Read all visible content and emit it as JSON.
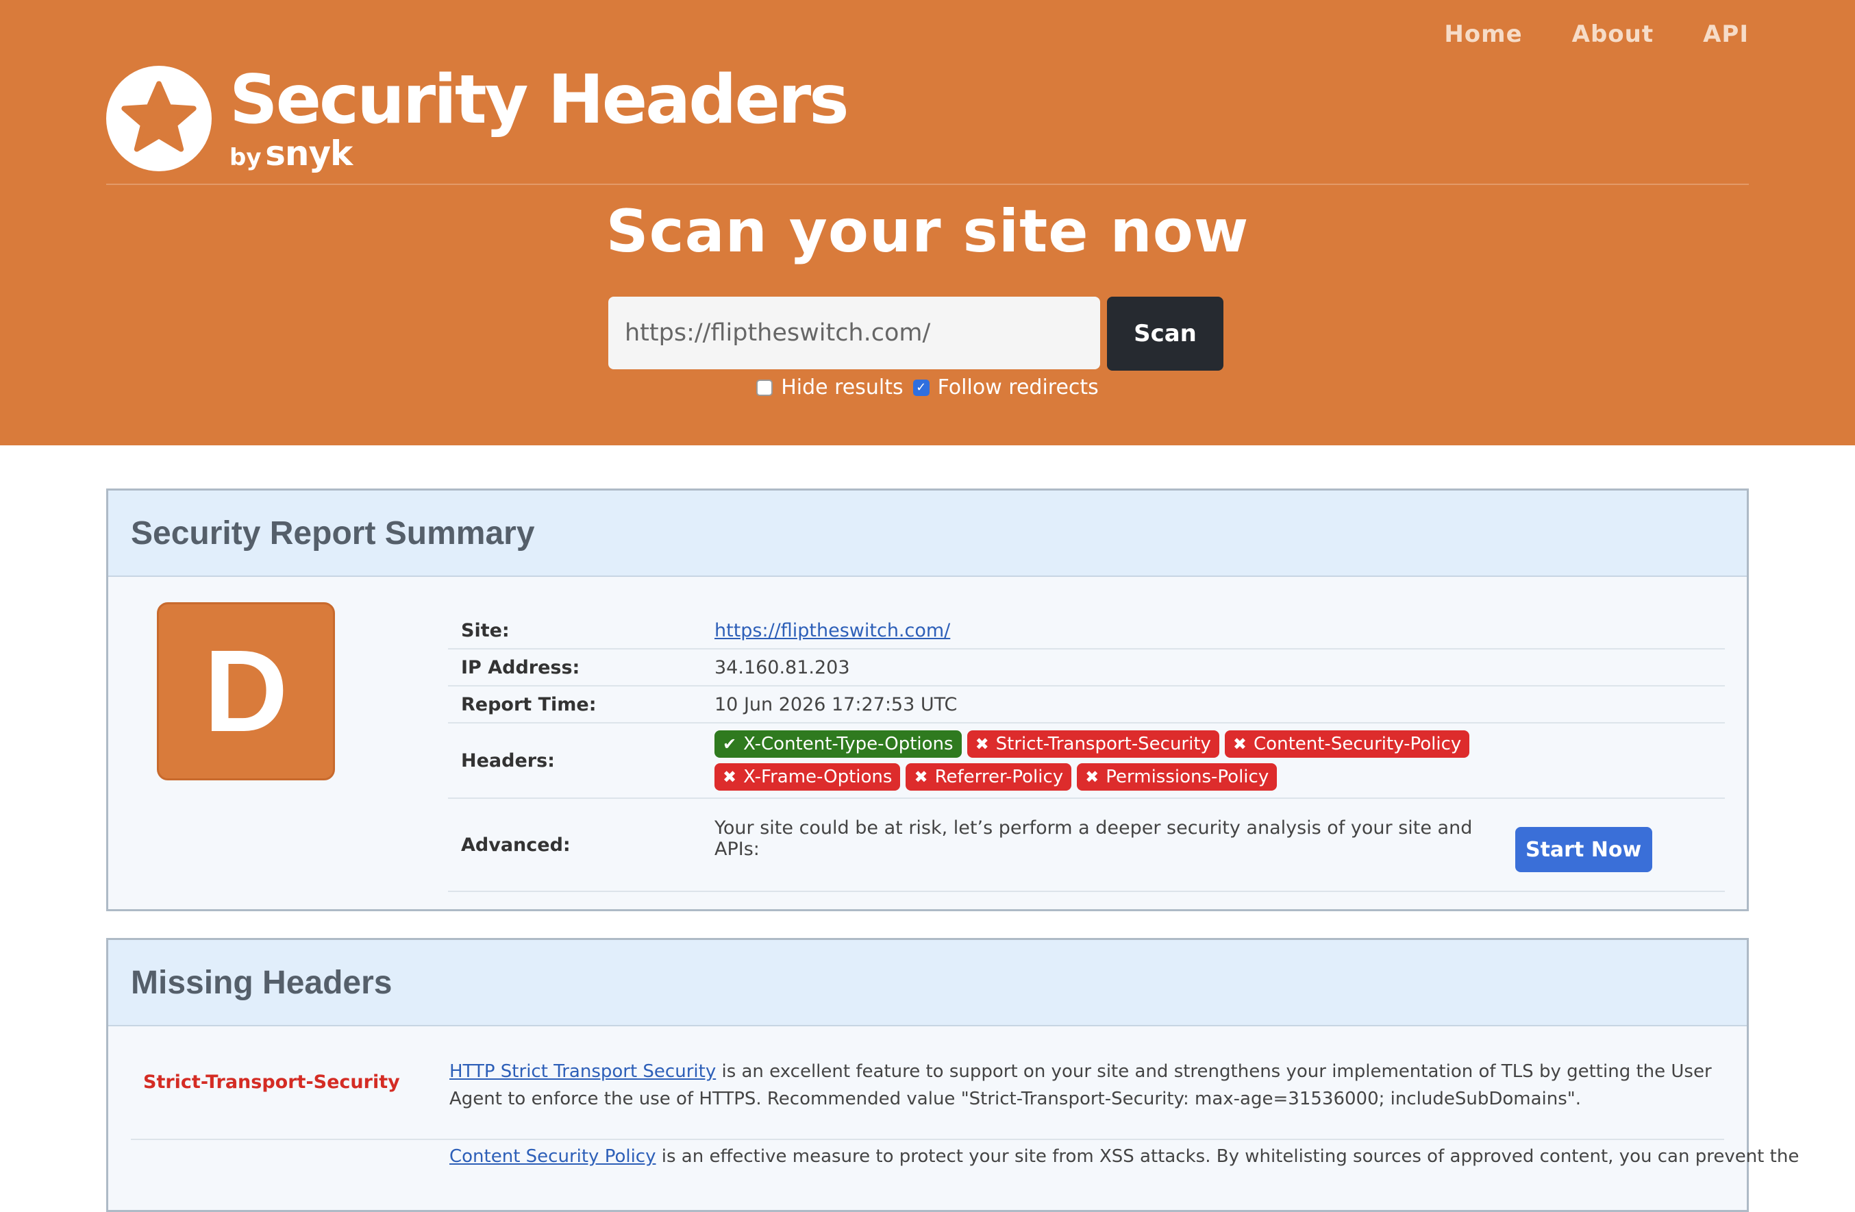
{
  "nav": {
    "home": "Home",
    "about": "About",
    "api": "API"
  },
  "logo": {
    "title": "Security Headers",
    "by": "by",
    "brand": "snyk",
    "icon": "star-icon"
  },
  "hero": {
    "title": "Scan your site now",
    "input_value": "https://fliptheswitch.com/",
    "scan_label": "Scan",
    "hide_results_label": "Hide results",
    "hide_results_checked": false,
    "follow_redirects_label": "Follow redirects",
    "follow_redirects_checked": true
  },
  "summary": {
    "title": "Security Report Summary",
    "grade": "D",
    "site_label": "Site:",
    "site_value": "https://fliptheswitch.com/",
    "ip_label": "IP Address:",
    "ip_value": "34.160.81.203",
    "time_label": "Report Time:",
    "time_value": "10 Jun 2026 17:27:53 UTC",
    "headers_label": "Headers:",
    "headers": [
      {
        "name": "X-Content-Type-Options",
        "status": "ok"
      },
      {
        "name": "Strict-Transport-Security",
        "status": "missing"
      },
      {
        "name": "Content-Security-Policy",
        "status": "missing"
      },
      {
        "name": "X-Frame-Options",
        "status": "missing"
      },
      {
        "name": "Referrer-Policy",
        "status": "missing"
      },
      {
        "name": "Permissions-Policy",
        "status": "missing"
      }
    ],
    "advanced_label": "Advanced:",
    "advanced_text": "Your site could be at risk, let’s perform a deeper security analysis of your site and APIs:",
    "start_label": "Start Now"
  },
  "missing": {
    "title": "Missing Headers",
    "rows": [
      {
        "name": "Strict-Transport-Security",
        "link": "HTTP Strict Transport Security",
        "text": " is an excellent feature to support on your site and strengthens your implementation of TLS by getting the User Agent to enforce the use of HTTPS. Recommended value \"Strict-Transport-Security: max-age=31536000; includeSubDomains\"."
      }
    ],
    "partial_link": "Content Security Policy",
    "partial_text": " is an effective measure to protect your site from XSS attacks. By whitelisting sources of approved content, you can prevent the"
  },
  "colors": {
    "brand": "#d97b3b",
    "ok": "#2f7a1f",
    "bad": "#dd2c2c",
    "button": "#3a6fd8"
  }
}
